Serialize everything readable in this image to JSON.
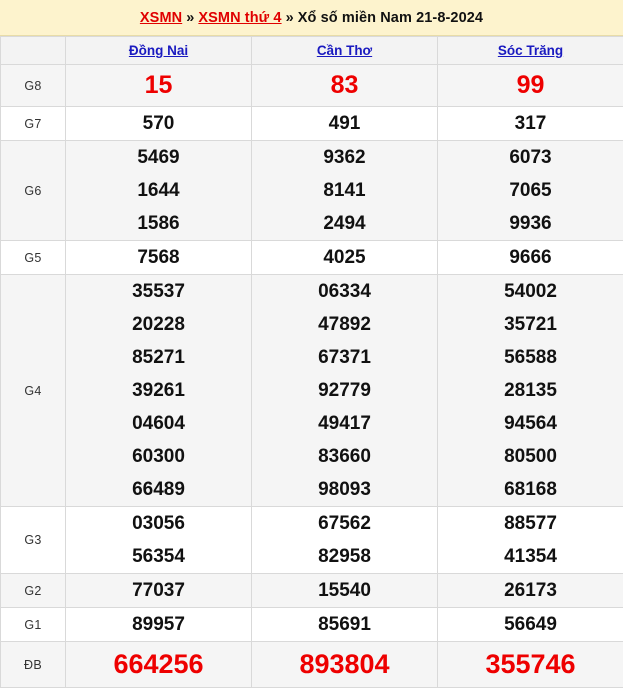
{
  "breadcrumb": {
    "link1": "XSMN",
    "sep1": "»",
    "link2": "XSMN thứ 4",
    "sep2": "»",
    "current": "Xổ số miền Nam 21-8-2024"
  },
  "table": {
    "corner_label": "",
    "provinces": [
      "Đồng Nai",
      "Cần Thơ",
      "Sóc Trăng"
    ],
    "rows": [
      {
        "prize": "G8",
        "values": [
          [
            "15"
          ],
          [
            "83"
          ],
          [
            "99"
          ]
        ]
      },
      {
        "prize": "G7",
        "values": [
          [
            "570"
          ],
          [
            "491"
          ],
          [
            "317"
          ]
        ]
      },
      {
        "prize": "G6",
        "values": [
          [
            "5469",
            "1644",
            "1586"
          ],
          [
            "9362",
            "8141",
            "2494"
          ],
          [
            "6073",
            "7065",
            "9936"
          ]
        ]
      },
      {
        "prize": "G5",
        "values": [
          [
            "7568"
          ],
          [
            "4025"
          ],
          [
            "9666"
          ]
        ]
      },
      {
        "prize": "G4",
        "values": [
          [
            "35537",
            "20228",
            "85271",
            "39261",
            "04604",
            "60300",
            "66489"
          ],
          [
            "06334",
            "47892",
            "67371",
            "92779",
            "49417",
            "83660",
            "98093"
          ],
          [
            "54002",
            "35721",
            "56588",
            "28135",
            "94564",
            "80500",
            "68168"
          ]
        ]
      },
      {
        "prize": "G3",
        "values": [
          [
            "03056",
            "56354"
          ],
          [
            "67562",
            "82958"
          ],
          [
            "88577",
            "41354"
          ]
        ]
      },
      {
        "prize": "G2",
        "values": [
          [
            "77037"
          ],
          [
            "15540"
          ],
          [
            "26173"
          ]
        ]
      },
      {
        "prize": "G1",
        "values": [
          [
            "89957"
          ],
          [
            "85691"
          ],
          [
            "56649"
          ]
        ]
      },
      {
        "prize": "ĐB",
        "values": [
          [
            "664256"
          ],
          [
            "893804"
          ],
          [
            "355746"
          ]
        ]
      }
    ]
  },
  "colors": {
    "breadcrumb_bg": "#fdf3cd",
    "breadcrumb_link": "#e00000",
    "province_link": "#1a1ac0",
    "highlight_number": "#ee0000",
    "number": "#111111",
    "stripe_bg": "#f5f5f5",
    "header_bg": "#f3f3f3",
    "border": "#d9d9d9"
  }
}
